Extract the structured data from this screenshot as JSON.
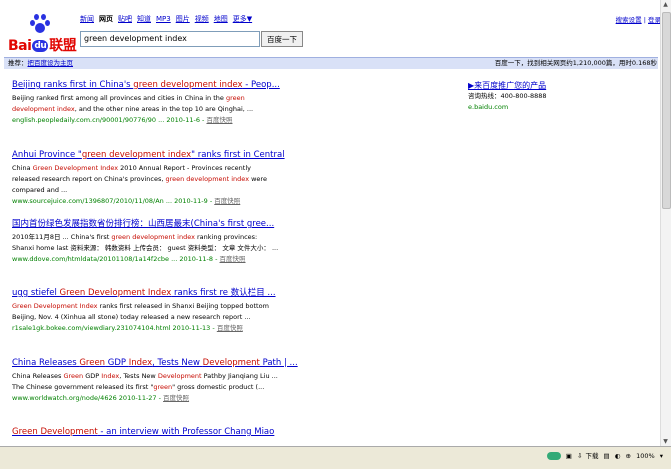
{
  "nav": {
    "items": [
      "新闻",
      "网页",
      "贴吧",
      "知道",
      "MP3",
      "图片",
      "视频",
      "地图"
    ],
    "current": "网页",
    "more": "更多▼"
  },
  "search": {
    "value": "green development index",
    "button_label": "百度一下"
  },
  "top_links": {
    "settings": "搜索设置",
    "separator": "|",
    "login": "登录"
  },
  "bar": {
    "recommend_label": "推荐：",
    "set_homepage": "把百度设为主页",
    "results_count": "百度一下，找到相关网页约1,210,000篇，用时0.168秒"
  },
  "results": [
    {
      "title": [
        [
          "Beijing ranks first in China's ",
          0
        ],
        [
          "green development index",
          1
        ],
        [
          " - Peop...",
          0
        ]
      ],
      "snippet": [
        [
          "Beijing ranked first among all provinces and cities in China in the ",
          0
        ],
        [
          "green development index",
          1
        ],
        [
          ", and the other nine areas in the top 10 are Qinghai, ...",
          0
        ]
      ],
      "url": "english.peopledaily.com.cn/90001/90776/90 ... 2010-11-6 - ",
      "cache": "百度快照"
    },
    {
      "title": [
        [
          "Anhui Province \"",
          0
        ],
        [
          "green development index",
          1
        ],
        [
          "\" ranks first in Central",
          0
        ]
      ],
      "snippet": [
        [
          "China ",
          0
        ],
        [
          "Green Development Index",
          1
        ],
        [
          " 2010 Annual Report - Provinces recently released research report on China's provinces, ",
          0
        ],
        [
          "green development index",
          1
        ],
        [
          " were compared and ...",
          0
        ]
      ],
      "url": "www.sourcejuice.com/1396807/2010/11/08/An ... 2010-11-9 - ",
      "cache": "百度快照"
    },
    {
      "title": [
        [
          "国内首份绿色发展指数省份排行榜：山西居最末(China's first gree...",
          0
        ]
      ],
      "snippet": [
        [
          "2010年11月8日 ... China's first ",
          0
        ],
        [
          "green development index",
          1
        ],
        [
          " ranking provinces: Shanxi home last 资料来源： 韩数资料 上传会员： guest 资料类型： 文章 文件大小： ...",
          0
        ]
      ],
      "url": "www.ddove.com/htmldata/20101108/1a14f2cbe ... 2010-11-8 - ",
      "cache": "百度快照"
    },
    {
      "title": [
        [
          "ugg stiefel ",
          0
        ],
        [
          "Green Development Index",
          1
        ],
        [
          " ranks first re 数认栏目 ...",
          0
        ]
      ],
      "snippet": [
        [
          "Green Development Index",
          1
        ],
        [
          " ranks first released in Shanxi Beijing topped bottom Beijing, Nov. 4 (Xinhua all stone) today released a new research report ...",
          0
        ]
      ],
      "url": "r1sale1gk.bokee.com/viewdiary.231074104.html 2010-11-13 - ",
      "cache": "百度快照"
    },
    {
      "title": [
        [
          "China Releases ",
          0
        ],
        [
          "Green",
          1
        ],
        [
          " GDP ",
          0
        ],
        [
          "Index",
          1
        ],
        [
          ", Tests New ",
          0
        ],
        [
          "Development",
          1
        ],
        [
          " Path | ...",
          0
        ]
      ],
      "snippet": [
        [
          "China Releases ",
          0
        ],
        [
          "Green",
          1
        ],
        [
          " GDP ",
          0
        ],
        [
          "Index",
          1
        ],
        [
          ", Tests New ",
          0
        ],
        [
          "Development",
          1
        ],
        [
          " Pathby Jianqiang Liu ... The Chinese government released its first \"",
          0
        ],
        [
          "green",
          1
        ],
        [
          "\" gross domestic product (...",
          0
        ]
      ],
      "url": "www.worldwatch.org/node/4626 2010-11-27 - ",
      "cache": "百度快照"
    },
    {
      "title": [
        [
          "Green Development",
          1
        ],
        [
          " - an interview with Professor Chang Miao",
          0
        ]
      ],
      "snippet": [],
      "url": "",
      "cache": ""
    }
  ],
  "ad": {
    "title": "▶来百度推广您的产品",
    "phone": "咨询热线：400-800-8888",
    "url": "e.baidu.com"
  },
  "status": {
    "download": "下载",
    "zoom": "100%"
  },
  "colors": {
    "link": "#0000cc",
    "highlight": "#c60a00",
    "url": "#008000",
    "logo_red": "#e10602",
    "logo_blue": "#2932e1"
  }
}
